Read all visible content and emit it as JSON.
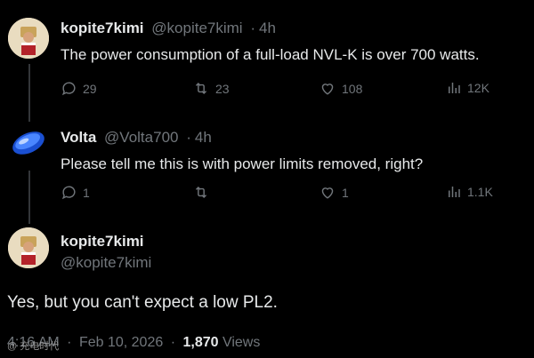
{
  "tweet1": {
    "display_name": "kopite7kimi",
    "handle": "@kopite7kimi",
    "time": "4h",
    "text": "The power consumption of a full-load NVL-K is over 700 watts.",
    "replies": "29",
    "reposts": "23",
    "likes": "108",
    "views": "12K"
  },
  "tweet2": {
    "display_name": "Volta",
    "handle": "@Volta700",
    "time": "4h",
    "text": "Please tell me this is with power limits removed, right?",
    "replies": "1",
    "reposts": "",
    "likes": "1",
    "views": "1.1K"
  },
  "main_tweet": {
    "display_name": "kopite7kimi",
    "handle": "@kopite7kimi",
    "text": "Yes, but you can't expect a low PL2.",
    "time": "4:16 AM",
    "date": "Feb 10, 2026",
    "views_count": "1,870",
    "views_label": "Views"
  },
  "watermark": "@ 充电时代"
}
